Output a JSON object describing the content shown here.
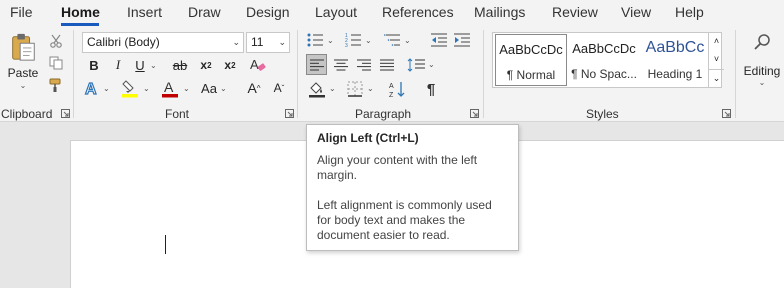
{
  "tabs": [
    "File",
    "Home",
    "Insert",
    "Draw",
    "Design",
    "Layout",
    "References",
    "Mailings",
    "Review",
    "View",
    "Help"
  ],
  "active_tab": "Home",
  "clipboard": {
    "paste_label": "Paste",
    "group_label": "Clipboard"
  },
  "font": {
    "name": "Calibri (Body)",
    "size": "11",
    "group_label": "Font",
    "grow_label": "A",
    "shrink_label": "A",
    "case_label": "Aa"
  },
  "paragraph": {
    "group_label": "Paragraph"
  },
  "styles": {
    "group_label": "Styles",
    "items": [
      {
        "sample": "AaBbCcDc",
        "name": "¶ Normal"
      },
      {
        "sample": "AaBbCcDc",
        "name": "¶ No Spac..."
      },
      {
        "sample": "AaBbCc",
        "name": "Heading 1"
      }
    ]
  },
  "editing": {
    "label": "Editing"
  },
  "tooltip": {
    "title": "Align Left (Ctrl+L)",
    "line1": "Align your content with the left margin.",
    "line2": "Left alignment is commonly used for body text and makes the document easier to read."
  },
  "colors": {
    "accent": "#185abd",
    "heading": "#2f5496",
    "highlight": "#ffff00",
    "font_color": "#c00000",
    "text_effect": "#2e75b6",
    "active_button": "#c5c5c5"
  }
}
